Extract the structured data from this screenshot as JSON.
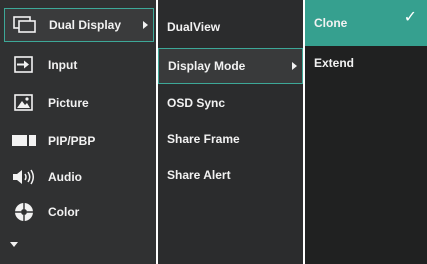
{
  "menu": {
    "items": [
      {
        "label": "Dual Display",
        "icon": "dual-display-icon"
      },
      {
        "label": "Input",
        "icon": "input-icon"
      },
      {
        "label": "Picture",
        "icon": "picture-icon"
      },
      {
        "label": "PIP/PBP",
        "icon": "pip-pbp-icon"
      },
      {
        "label": "Audio",
        "icon": "audio-icon"
      },
      {
        "label": "Color",
        "icon": "color-icon"
      }
    ],
    "more_icon": "chevron-down-icon"
  },
  "submenu": {
    "items": [
      {
        "label": "DualView"
      },
      {
        "label": "Display Mode"
      },
      {
        "label": "OSD Sync"
      },
      {
        "label": "Share Frame"
      },
      {
        "label": "Share Alert"
      }
    ]
  },
  "options": {
    "items": [
      {
        "label": "Clone"
      },
      {
        "label": "Extend"
      }
    ],
    "check_icon": "checkmark-icon"
  },
  "colors": {
    "accent": "#36a08f",
    "panel_bg": "#303132",
    "text": "#f2f2f2"
  }
}
